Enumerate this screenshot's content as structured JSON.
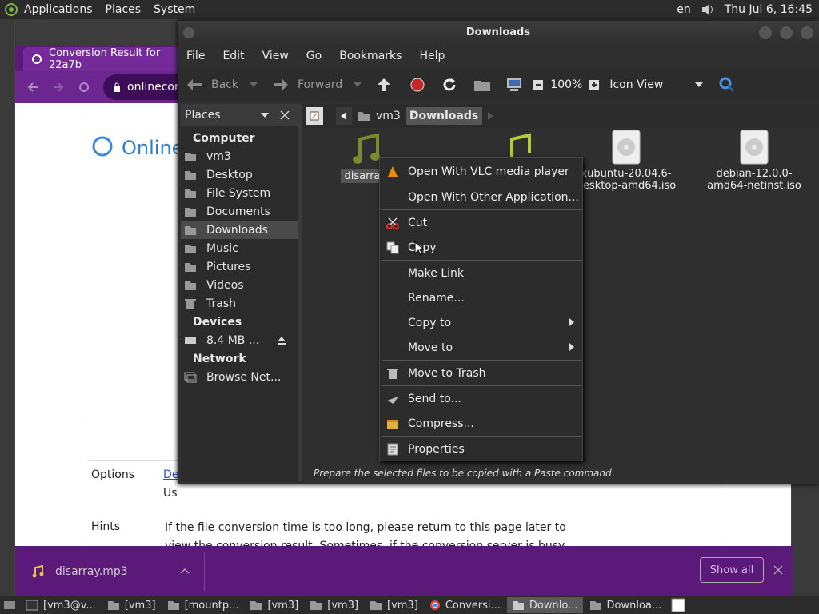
{
  "top_panel": {
    "menus": [
      "Applications",
      "Places",
      "System"
    ],
    "keyboard": "en",
    "clock": "Thu Jul  6, 16:45"
  },
  "browser": {
    "tab_title": "Conversion Result for 22a7b",
    "url": "onlinecon",
    "page_heading": "Online",
    "options_label": "Options",
    "options_item1": "De",
    "options_item2": "Us",
    "hints_label": "Hints",
    "hints_text": "If the file conversion time is too long, please return to this page later to view the conversion result. Sometimes, if the conversion server is busy, file queuing will take a while.",
    "download_file": "disarray.mp3",
    "show_all": "Show all"
  },
  "file_manager": {
    "title": "Downloads",
    "menubar": [
      "File",
      "Edit",
      "View",
      "Go",
      "Bookmarks",
      "Help"
    ],
    "toolbar": {
      "back": "Back",
      "forward": "Forward",
      "zoom": "100%",
      "view_mode": "Icon View"
    },
    "sidebar": {
      "header": "Places",
      "computer_label": "Computer",
      "computer_items": [
        "vm3",
        "Desktop",
        "File System",
        "Documents",
        "Downloads",
        "Music",
        "Pictures",
        "Videos",
        "Trash"
      ],
      "devices_label": "Devices",
      "devices_items": [
        "8.4 MB ..."
      ],
      "network_label": "Network",
      "network_items": [
        "Browse Net..."
      ]
    },
    "path": [
      "vm3",
      "Downloads"
    ],
    "files": [
      {
        "name": "disarray.",
        "icon": "music-icon"
      },
      {
        "name": "",
        "icon": "music-icon"
      },
      {
        "name": "xubuntu-20.04.6-\ndesktop-amd64.iso",
        "icon": "disc-icon"
      },
      {
        "name": "debian-12.0.0-\namd64-netinst.iso",
        "icon": "disc-icon"
      }
    ],
    "status": "Prepare the selected files to be copied with a Paste command"
  },
  "context_menu": {
    "items": [
      "Open With VLC media player",
      "Open With Other Application...",
      "Cut",
      "Copy",
      "Make Link",
      "Rename...",
      "Copy to",
      "Move to",
      "Move to Trash",
      "Send to...",
      "Compress...",
      "Properties"
    ]
  },
  "bottom_panel": {
    "tasks": [
      "[vm3@v...",
      "[vm3]",
      "[mountp...",
      "[vm3]",
      "[vm3]",
      "[vm3]",
      "Conversi...",
      "Downlo...",
      "Downloa..."
    ]
  },
  "colors": {
    "accent_purple": "#5b1a7a",
    "dark_bg": "#2f2f2f"
  }
}
